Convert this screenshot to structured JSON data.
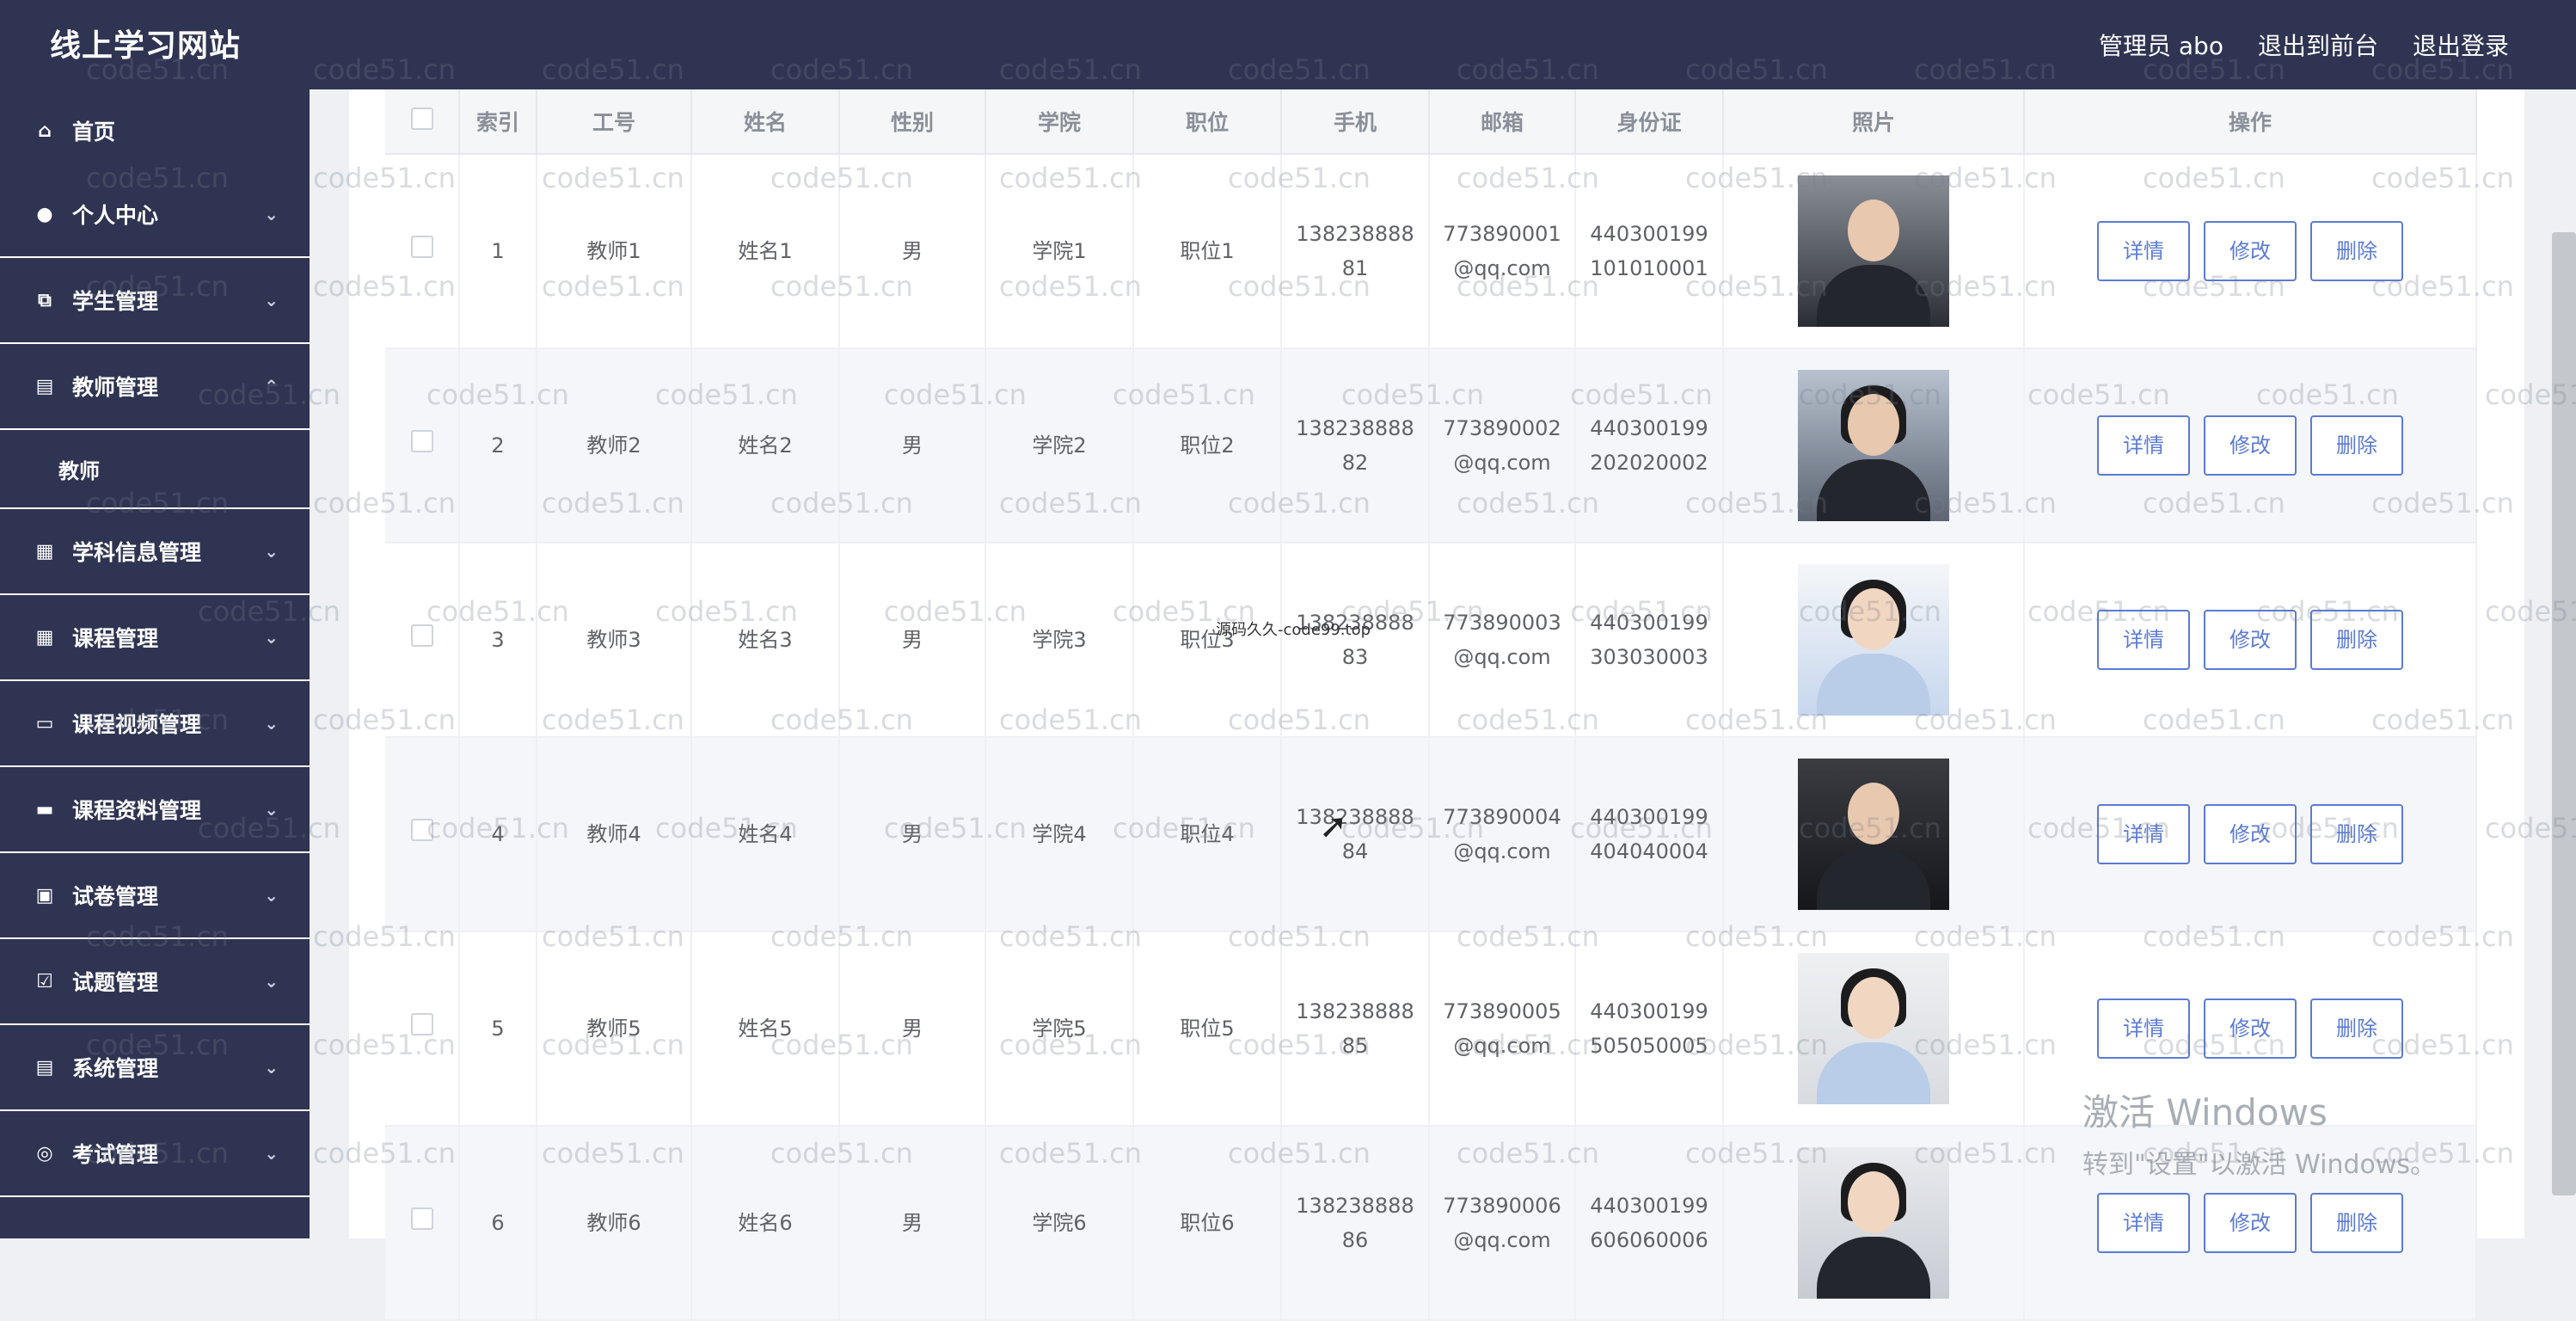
{
  "header": {
    "brand": "线上学习网站",
    "links": [
      "管理员 abo",
      "退出到前台",
      "退出登录"
    ]
  },
  "sidebar": {
    "items": [
      {
        "label": "首页",
        "icon": "home-icon",
        "glyph": "⌂",
        "arrow": ""
      },
      {
        "label": "个人中心",
        "icon": "user-icon",
        "glyph": "●",
        "arrow": "⌄"
      },
      {
        "label": "学生管理",
        "icon": "copy-icon",
        "glyph": "⧉",
        "arrow": "⌄"
      },
      {
        "label": "教师管理",
        "icon": "clipboard-icon",
        "glyph": "▤",
        "arrow": "⌃"
      },
      {
        "label": "学科信息管理",
        "icon": "briefcase-icon",
        "glyph": "▦",
        "arrow": "⌄"
      },
      {
        "label": "课程管理",
        "icon": "grid-icon",
        "glyph": "▦",
        "arrow": "⌄"
      },
      {
        "label": "课程视频管理",
        "icon": "chat-icon",
        "glyph": "▭",
        "arrow": "⌄"
      },
      {
        "label": "课程资料管理",
        "icon": "monitor-icon",
        "glyph": "▬",
        "arrow": "⌄"
      },
      {
        "label": "试卷管理",
        "icon": "printer-icon",
        "glyph": "▣",
        "arrow": "⌄"
      },
      {
        "label": "试题管理",
        "icon": "checklist-icon",
        "glyph": "☑",
        "arrow": "⌄"
      },
      {
        "label": "系统管理",
        "icon": "card-icon",
        "glyph": "▤",
        "arrow": "⌄"
      },
      {
        "label": "考试管理",
        "icon": "compass-icon",
        "glyph": "◎",
        "arrow": "⌄"
      }
    ],
    "sub_item": "教师"
  },
  "table": {
    "headers": [
      "索引",
      "工号",
      "姓名",
      "性别",
      "学院",
      "职位",
      "手机",
      "邮箱",
      "身份证",
      "照片",
      "操作"
    ],
    "actions": [
      "详情",
      "修改",
      "删除"
    ],
    "rows": [
      {
        "index": "1",
        "id": "教师1",
        "name": "姓名1",
        "gender": "男",
        "college": "学院1",
        "position": "职位1",
        "phone1": "138238888",
        "phone2": "81",
        "email1": "773890001",
        "email2": "@qq.com",
        "idcard1": "440300199",
        "idcard2": "101010001"
      },
      {
        "index": "2",
        "id": "教师2",
        "name": "姓名2",
        "gender": "男",
        "college": "学院2",
        "position": "职位2",
        "phone1": "138238888",
        "phone2": "82",
        "email1": "773890002",
        "email2": "@qq.com",
        "idcard1": "440300199",
        "idcard2": "202020002"
      },
      {
        "index": "3",
        "id": "教师3",
        "name": "姓名3",
        "gender": "男",
        "college": "学院3",
        "position": "职位3",
        "phone1": "138238888",
        "phone2": "83",
        "email1": "773890003",
        "email2": "@qq.com",
        "idcard1": "440300199",
        "idcard2": "303030003"
      },
      {
        "index": "4",
        "id": "教师4",
        "name": "姓名4",
        "gender": "男",
        "college": "学院4",
        "position": "职位4",
        "phone1": "138238888",
        "phone2": "84",
        "email1": "773890004",
        "email2": "@qq.com",
        "idcard1": "440300199",
        "idcard2": "404040004"
      },
      {
        "index": "5",
        "id": "教师5",
        "name": "姓名5",
        "gender": "男",
        "college": "学院5",
        "position": "职位5",
        "phone1": "138238888",
        "phone2": "85",
        "email1": "773890005",
        "email2": "@qq.com",
        "idcard1": "440300199",
        "idcard2": "505050005"
      },
      {
        "index": "6",
        "id": "教师6",
        "name": "姓名6",
        "gender": "男",
        "college": "学院6",
        "position": "职位6",
        "phone1": "138238888",
        "phone2": "86",
        "email1": "773890006",
        "email2": "@qq.com",
        "idcard1": "440300199",
        "idcard2": "606060006"
      }
    ]
  },
  "overlay_text": "源码久久-code99.top",
  "watermark": "code51.cn",
  "windows_activation": {
    "line1": "激活 Windows",
    "line2": "转到\"设置\"以激活 Windows。"
  }
}
